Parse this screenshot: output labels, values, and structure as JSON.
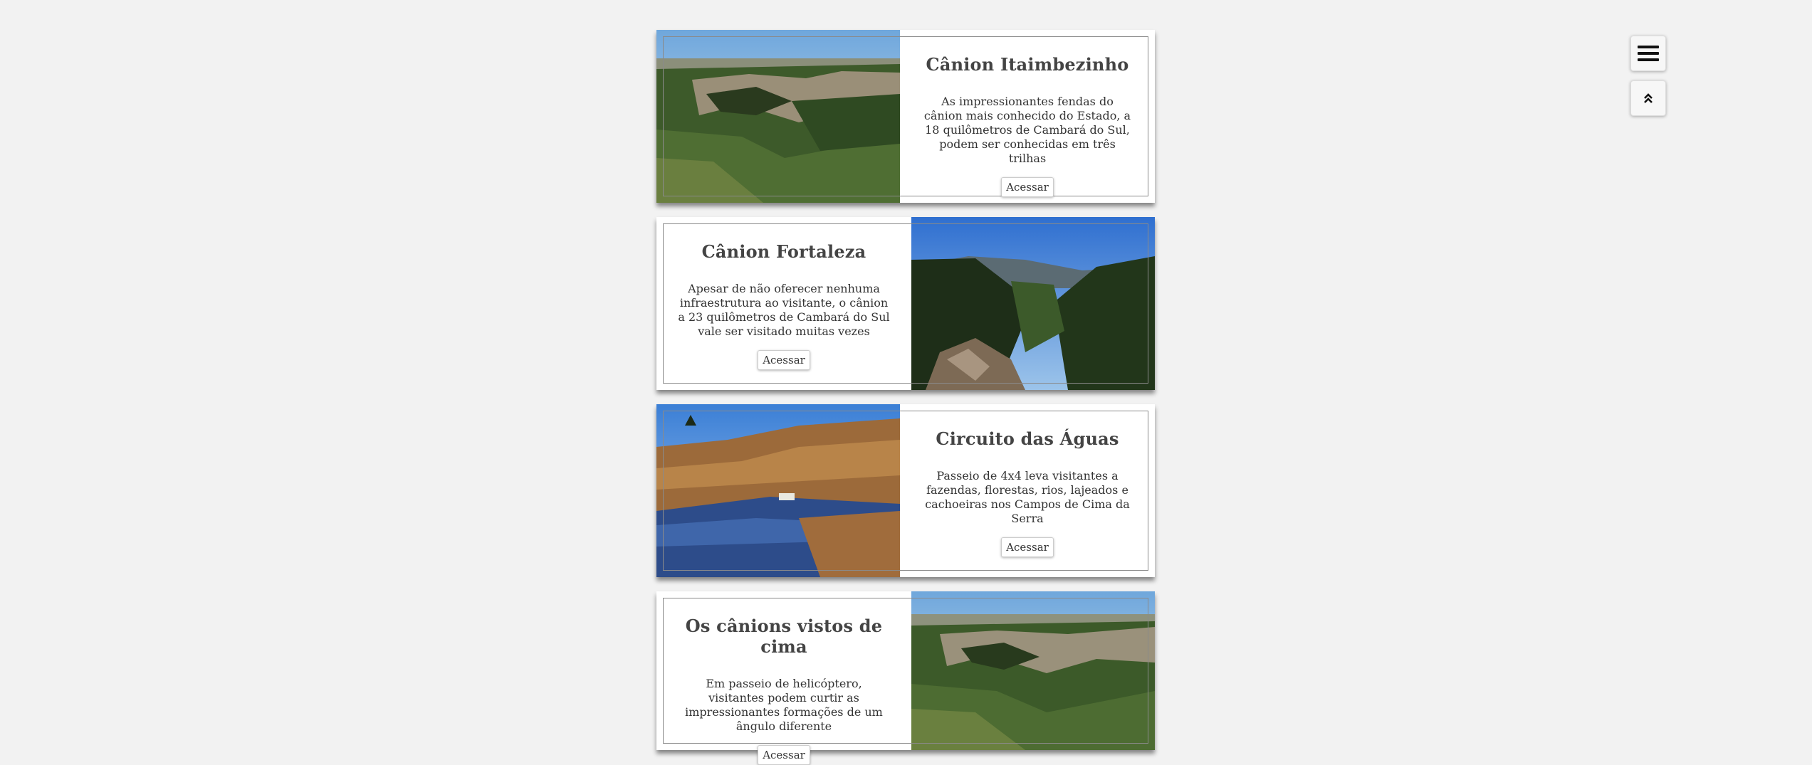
{
  "cards": [
    {
      "title": "Cânion Itaimbezinho",
      "description": "As impressionantes fendas do cânion mais conhecido do Estado, a 18 quilômetros de Cambará do Sul, podem ser conhecidas em três trilhas",
      "button_label": "Acessar"
    },
    {
      "title": "Cânion Fortaleza",
      "description": "Apesar de não oferecer nenhuma infraestrutura ao visitante, o cânion a 23 quilômetros de Cambará do Sul vale ser visitado muitas vezes",
      "button_label": "Acessar"
    },
    {
      "title": "Circuito das Águas",
      "description": "Passeio de 4x4 leva visitantes a fazendas, florestas, rios, lajeados e cachoeiras nos Campos de Cima da Serra",
      "button_label": "Acessar"
    },
    {
      "title": "Os cânions vistos de cima",
      "description": "Em passeio de helicóptero, visitantes podem curtir as impressionantes formações de um ângulo diferente",
      "button_label": "Acessar"
    }
  ],
  "controls": {
    "menu_icon": "hamburger-menu-icon",
    "scroll_top_icon": "double-chevron-up-icon"
  }
}
